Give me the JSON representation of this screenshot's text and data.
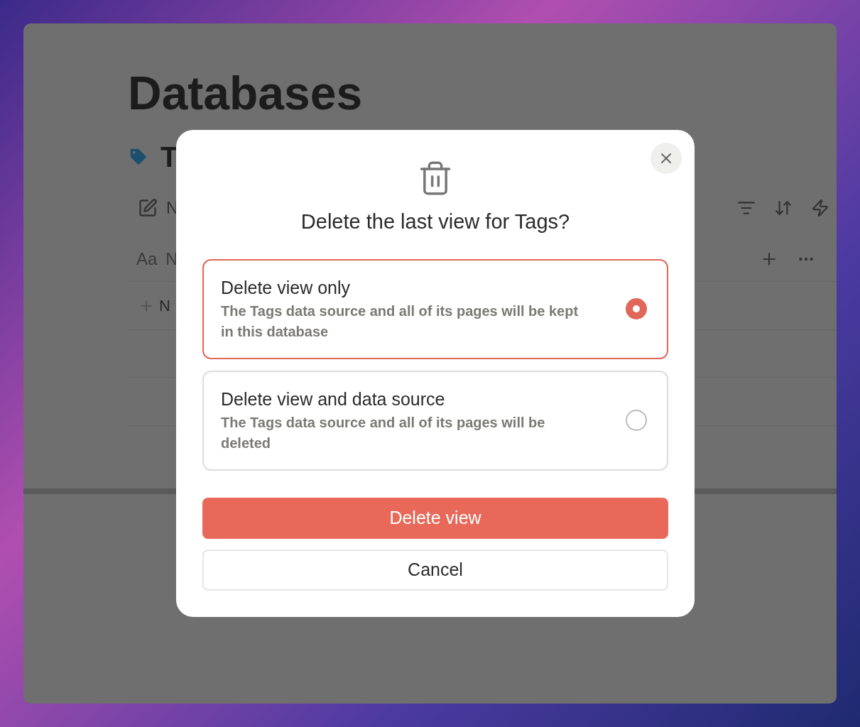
{
  "page": {
    "title": "Databases",
    "database_title": "T",
    "view_tab": "N",
    "type_label": "Aa",
    "column_header": "N",
    "new_row": "N"
  },
  "dialog": {
    "title": "Delete the last view for Tags?",
    "options": [
      {
        "title": "Delete view only",
        "description": "The Tags data source and all of its pages will be kept in this database",
        "selected": true
      },
      {
        "title": "Delete view and data source",
        "description": "The Tags data source and all of its pages will be deleted",
        "selected": false
      }
    ],
    "confirm_button": "Delete view",
    "cancel_button": "Cancel"
  }
}
